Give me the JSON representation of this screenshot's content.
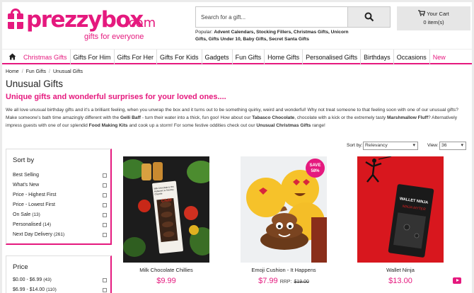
{
  "brand": {
    "name": "prezzybox",
    "tld": ".com",
    "tagline": "gifts for everyone",
    "color": "#e5197e"
  },
  "search": {
    "placeholder": "Search for a gift...",
    "icon": "search-icon"
  },
  "popular": {
    "label": "Popular:",
    "items": "Advent Calendars, Stocking Fillers, Christmas Gifts, Unicorn Gifts, Gifts Under 10, Baby Gifts, Secret Santa Gifts"
  },
  "cart": {
    "label": "Your Cart",
    "items": "0 item(s)",
    "icon": "cart-icon"
  },
  "nav": {
    "home_icon": "home-icon",
    "items": [
      "Christmas Gifts",
      "Gifts For Him",
      "Gifts For Her",
      "Gifts For Kids",
      "Gadgets",
      "Fun Gifts",
      "Home Gifts",
      "Personalised Gifts",
      "Birthdays",
      "Occasions",
      "New"
    ]
  },
  "breadcrumb": [
    "Home",
    "Fun Gifts",
    "Unusual Gifts"
  ],
  "page": {
    "title": "Unusual Gifts",
    "subtitle": "Unique gifts and wonderful surprises for your loved ones....",
    "intro": [
      {
        "t": "We all love unusual birthday gifts and it's a brilliant feeling, when you unwrap the box and it turns out to be something quirky, weird and wonderful! Why not treat someone to that feeling soon with one of our unusual gifts? Make someone's bath time amazingly different with the ",
        "b": false
      },
      {
        "t": "Gelli Baff",
        "b": true
      },
      {
        "t": " - turn their water into a thick, fun goo! How about our ",
        "b": false
      },
      {
        "t": "Tabasco Chocolate",
        "b": true
      },
      {
        "t": ", chocolate with a kick or the extremely tasty ",
        "b": false
      },
      {
        "t": "Marshmallow Fluff",
        "b": true
      },
      {
        "t": "? Alternatively impress guests with one of our splendid ",
        "b": false
      },
      {
        "t": "Food Making Kits",
        "b": true
      },
      {
        "t": " and cook up a storm! For some festive oddities check out our ",
        "b": false
      },
      {
        "t": "Unusual Christmas Gifts",
        "b": true
      },
      {
        "t": " range!",
        "b": false
      }
    ]
  },
  "sort_panel": {
    "title": "Sort by",
    "options": [
      {
        "label": "Best Selling",
        "count": ""
      },
      {
        "label": "What's New",
        "count": ""
      },
      {
        "label": "Price - Highest First",
        "count": ""
      },
      {
        "label": "Price - Lowest First",
        "count": ""
      },
      {
        "label": "On Sale",
        "count": "(13)"
      },
      {
        "label": "Personalised",
        "count": "(14)"
      },
      {
        "label": "Next Day Delivery",
        "count": "(261)"
      }
    ]
  },
  "price_panel": {
    "title": "Price",
    "options": [
      {
        "label": "$0.00 - $6.99",
        "count": "(43)"
      },
      {
        "label": "$6.99 - $14.00",
        "count": "(110)"
      }
    ]
  },
  "toolbar": {
    "sort_label": "Sort by:",
    "sort_value": "Relevancy",
    "view_label": "View:",
    "view_value": "36"
  },
  "products": [
    {
      "name": "Milk Chocolate Chillies",
      "price": "$9.99",
      "rrp_label": "",
      "rrp": "",
      "badge": ""
    },
    {
      "name": "Emoji Cushion - It Happens",
      "price": "$7.99",
      "rrp_label": "RRP:",
      "rrp": "$19.00",
      "badge": "SAVE 58%"
    },
    {
      "name": "Wallet Ninja",
      "price": "$13.00",
      "rrp_label": "",
      "rrp": "",
      "badge": ""
    }
  ],
  "product_images": {
    "p1_label": "Chilli",
    "p1_box_text": "Milk Chocolate & Hot Habanero & Smokey Chipotle",
    "p3_title": "WALLET NINJA",
    "p3_sub": "NINJA MYTER"
  },
  "icons": {
    "video": "video-play-icon"
  }
}
